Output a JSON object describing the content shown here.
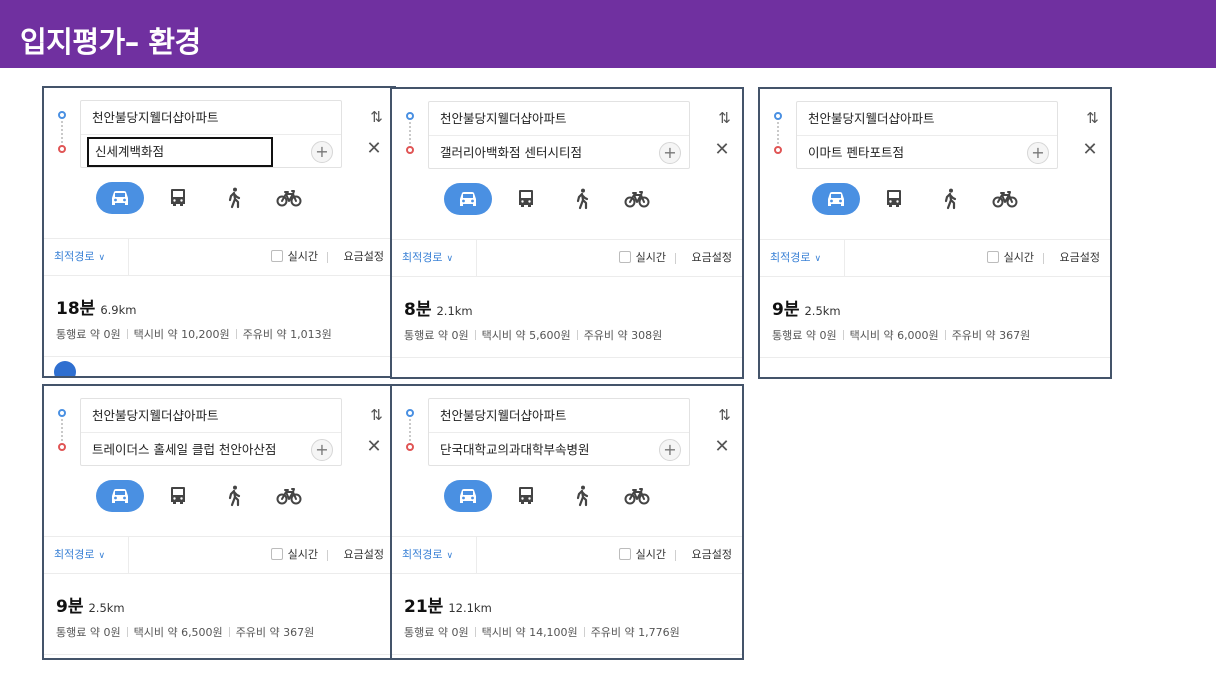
{
  "header": {
    "title": "입지평가– 환경"
  },
  "colors": {
    "header_bg": "#7030a0",
    "accent": "#4a90e2",
    "border": "#44546a"
  },
  "icons": {
    "origin": "origin-dot-icon",
    "destination": "destination-dot-icon",
    "swap": "swap-arrows-icon",
    "close": "close-icon",
    "add": "plus-icon",
    "car": "car-icon",
    "bus": "bus-icon",
    "walk": "walk-icon",
    "bike": "bicycle-icon",
    "dropdown": "chevron-down-icon",
    "checkbox": "checkbox-icon"
  },
  "common": {
    "swap_glyph": "⇅",
    "close_glyph": "✕",
    "add_glyph": "+",
    "chevron_glyph": "∨",
    "best_route": "최적경로",
    "realtime": "실시간",
    "fare_setting": "요금설정"
  },
  "panels": [
    {
      "origin": "천안불당지웰더샵아파트",
      "destination": "신세계백화점",
      "duration": "18분",
      "distance": "6.9km",
      "toll": "통행료 약 0원",
      "taxi": "택시비 약 10,200원",
      "fuel": "주유비 약 1,013원"
    },
    {
      "origin": "천안불당지웰더샵아파트",
      "destination": "갤러리아백화점 센터시티점",
      "duration": "8분",
      "distance": "2.1km",
      "toll": "통행료 약 0원",
      "taxi": "택시비 약 5,600원",
      "fuel": "주유비 약 308원"
    },
    {
      "origin": "천안불당지웰더샵아파트",
      "destination": "이마트 펜타포트점",
      "duration": "9분",
      "distance": "2.5km",
      "toll": "통행료 약 0원",
      "taxi": "택시비 약 6,000원",
      "fuel": "주유비 약 367원"
    },
    {
      "origin": "천안불당지웰더샵아파트",
      "destination": "트레이더스 홀세일 클럽 천안아산점",
      "duration": "9분",
      "distance": "2.5km",
      "toll": "통행료 약 0원",
      "taxi": "택시비 약 6,500원",
      "fuel": "주유비 약 367원"
    },
    {
      "origin": "천안불당지웰더샵아파트",
      "destination": "단국대학교의과대학부속병원",
      "duration": "21분",
      "distance": "12.1km",
      "toll": "통행료 약 0원",
      "taxi": "택시비 약 14,100원",
      "fuel": "주유비 약 1,776원"
    }
  ]
}
